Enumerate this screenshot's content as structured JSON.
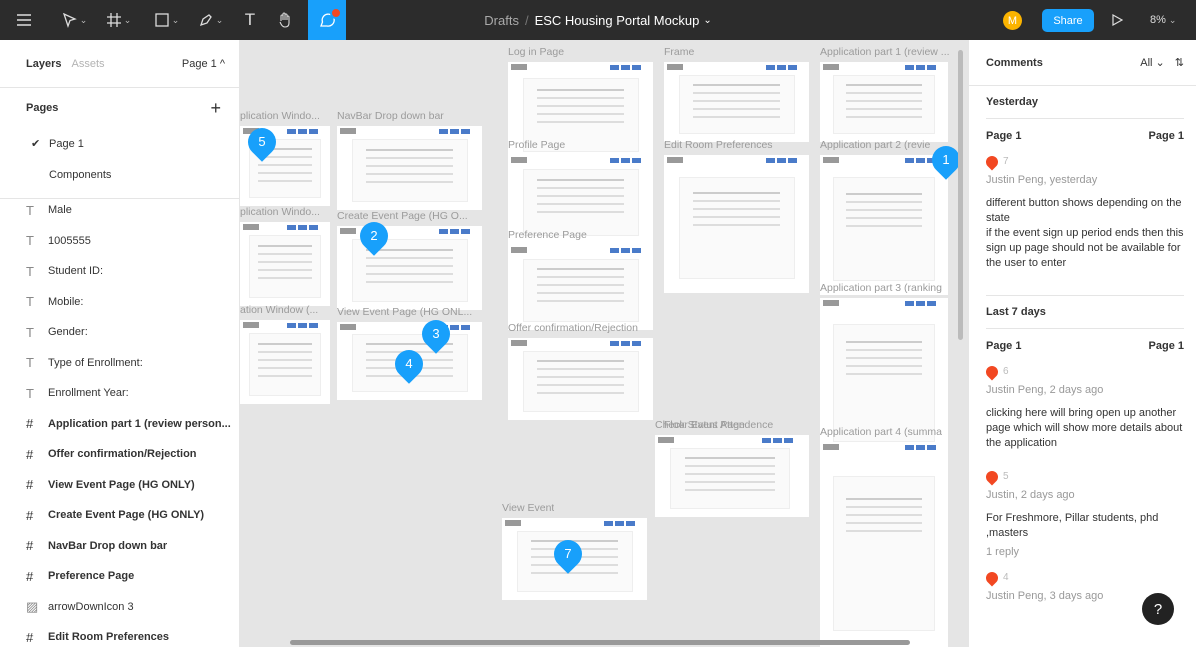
{
  "toolbar": {
    "breadcrumb": "Drafts",
    "separator": "/",
    "file_name": "ESC Housing Portal Mockup",
    "file_caret": "⌄",
    "avatar_initial": "M",
    "share_label": "Share",
    "zoom_level": "8%",
    "accent": "#18a0fb"
  },
  "left_panel": {
    "tab_layers": "Layers",
    "tab_assets": "Assets",
    "page_selector": "Page 1 ^",
    "pages_heading": "Pages",
    "add_page": "+",
    "pages": [
      {
        "label": "Page 1",
        "check": "✔"
      },
      {
        "label": "Components",
        "check": ""
      }
    ],
    "layers": [
      {
        "type": "text",
        "glyph": "T",
        "label": "Male"
      },
      {
        "type": "text",
        "glyph": "T",
        "label": "1005555"
      },
      {
        "type": "text",
        "glyph": "T",
        "label": "Student ID:"
      },
      {
        "type": "text",
        "glyph": "T",
        "label": "Mobile:"
      },
      {
        "type": "text",
        "glyph": "T",
        "label": "Gender:"
      },
      {
        "type": "text",
        "glyph": "T",
        "label": "Type of Enrollment:"
      },
      {
        "type": "text",
        "glyph": "T",
        "label": "Enrollment Year:"
      },
      {
        "type": "frame",
        "glyph": "#",
        "label": "Application part 1 (review person..."
      },
      {
        "type": "frame",
        "glyph": "#",
        "label": "Offer confirmation/Rejection"
      },
      {
        "type": "frame",
        "glyph": "#",
        "label": "View Event Page (HG ONLY)"
      },
      {
        "type": "frame",
        "glyph": "#",
        "label": "Create Event Page (HG ONLY)"
      },
      {
        "type": "frame",
        "glyph": "#",
        "label": "NavBar Drop down bar"
      },
      {
        "type": "frame",
        "glyph": "#",
        "label": "Preference Page"
      },
      {
        "type": "image",
        "glyph": "▨",
        "label": "arrowDownIcon 3"
      },
      {
        "type": "frame",
        "glyph": "#",
        "label": "Edit Room Preferences"
      }
    ]
  },
  "canvas": {
    "frames": [
      "plication Windo...",
      "NavBar Drop down bar",
      "plication Windo...",
      "Create Event Page (HG O...",
      "ation Window (...",
      "View Event Page (HG ONL...",
      "Log in Page",
      "Frame",
      "Application part 1 (review ...",
      "Profile Page",
      "Edit Room Preferences",
      "Application part 2 (revie",
      "Preference Page",
      "Offer confirmation/Rejection",
      "Application part 3 (ranking",
      "Floor Event Attendence",
      "Check Status Page",
      "Application part 4 (summa",
      "View Event"
    ],
    "pins": [
      "5",
      "2",
      "3",
      "4",
      "1",
      "7"
    ]
  },
  "comments_panel": {
    "title": "Comments",
    "filter": "All ⌄",
    "filter_icon": "⇅",
    "groups": [
      {
        "label": "Yesterday",
        "items": [
          {
            "page": "Page 1",
            "page_right": "Page 1",
            "number": "7",
            "author": "Justin Peng, yesterday",
            "text": "different button shows depending on the state\nif the event sign up period ends then this sign up page should not be available for the user to enter",
            "replies": ""
          }
        ]
      },
      {
        "label": "Last 7 days",
        "items": [
          {
            "page": "Page 1",
            "page_right": "Page 1",
            "number": "6",
            "author": "Justin Peng, 2 days ago",
            "text": "clicking here will bring open up another page which will show more details about the application",
            "replies": ""
          },
          {
            "page": "",
            "page_right": "",
            "number": "5",
            "author": "Justin, 2 days ago",
            "text": "For Freshmore, Pillar students, phd ,masters",
            "replies": "1 reply"
          },
          {
            "page": "",
            "page_right": "",
            "number": "4",
            "author": "Justin Peng, 3 days ago",
            "text": "",
            "replies": ""
          }
        ]
      }
    ],
    "help": "?"
  }
}
